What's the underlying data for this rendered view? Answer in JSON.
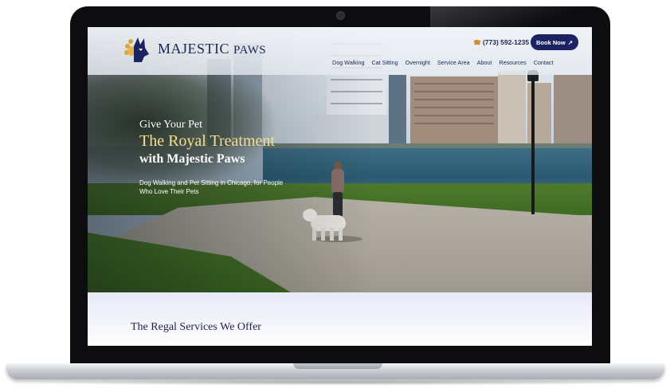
{
  "site": {
    "brand_name": "MAJESTIC",
    "brand_name_2": "PAWS",
    "logo_icon": "majestic-paws-dog-paw-logo",
    "phone": "(773) 592-1235",
    "book_button": "Book Now",
    "book_icon": "arrow-up-right-icon",
    "nav": [
      "Dog Walking",
      "Cat Sitting",
      "Overnight",
      "Service Area",
      "About",
      "Resources",
      "Contact"
    ]
  },
  "hero": {
    "pre_title": "Give Your Pet",
    "main_title": "The Royal Treatment",
    "post_title": "with Majestic Paws",
    "subtitle": "Dog Walking and Pet Sitting in Chicago, for People Who Love Their Pets"
  },
  "section": {
    "title": "The Regal Services We Offer"
  },
  "colors": {
    "navy": "#1b2462",
    "gold": "#f3e08a",
    "accent_orange": "#d38b2f"
  }
}
